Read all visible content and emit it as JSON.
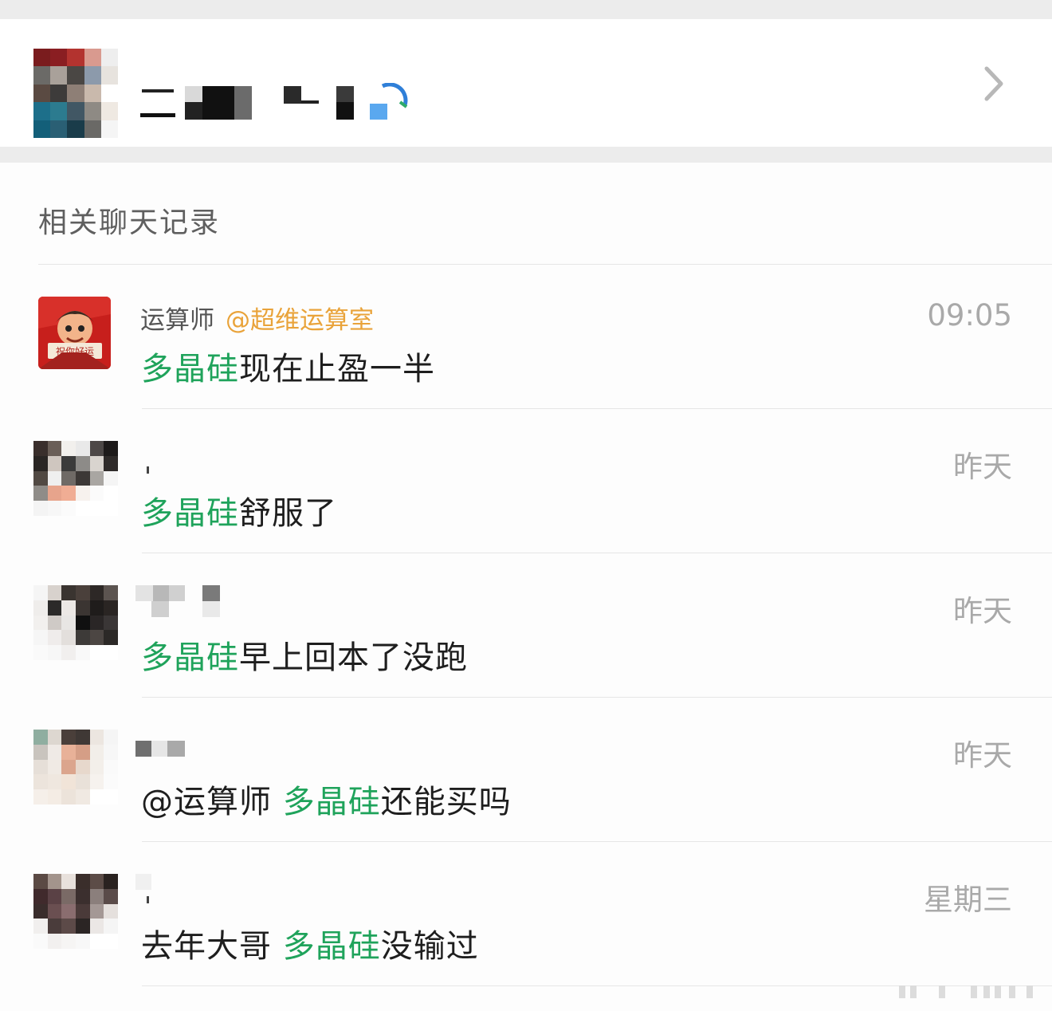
{
  "contact": {
    "name": "",
    "avatar_colors": [
      "#7a1c1e",
      "#8a1e22",
      "#b3332f",
      "#d99a8f",
      "#eeeeee",
      "#6b6a67",
      "#a9a19a",
      "#4a4744",
      "#8c9aab",
      "#e7e3de",
      "#5a4a42",
      "#3d3b3a",
      "#8e7f76",
      "#c9b9ac",
      "#ffffff",
      "#1d6f8a",
      "#2c7b8f",
      "#415764",
      "#8e8a84",
      "#efe9e2",
      "#135f79",
      "#2a5f74",
      "#1a3c4a",
      "#6a6966",
      "#f5f5f5"
    ],
    "chevron_icon": "chevron-right-icon"
  },
  "section": {
    "title": "相关聊天记录"
  },
  "colors": {
    "keyword": "#1fa35b",
    "group_mention": "#e9a33a",
    "time": "#a9a9a9"
  },
  "results": [
    {
      "sender": "运算师",
      "group": "@超维运算室",
      "time": "09:05",
      "keyword": "多晶硅",
      "before": "",
      "after": "现在止盈一半",
      "avatar_caption": "祝你好运"
    },
    {
      "sender": "",
      "group": "",
      "time": "昨天",
      "keyword": "多晶硅",
      "before": "",
      "after": "舒服了",
      "avatar_colors": [
        "#3a2f2c",
        "#6a5e57",
        "#f2f0ed",
        "#e9e9e9",
        "#4d4847",
        "#1d1a1a",
        "#2a2624",
        "#cfc6bf",
        "#3b3b3b",
        "#8d8b88",
        "#d9d4cf",
        "#2f2b2a",
        "#514943",
        "#efefef",
        "#6f6a66",
        "#3c3836",
        "#a9a6a2",
        "#f5f5f5",
        "#8f8c88",
        "#e7a48c",
        "#f0ad94",
        "#f7f2ee",
        "#fbfbfb",
        "#ffffff",
        "#f4f4f4",
        "#f7f7f7",
        "#fbfbfb",
        "#ffffff",
        "#ffffff",
        "#ffffff"
      ]
    },
    {
      "sender": "",
      "group": "",
      "time": "昨天",
      "keyword": "多晶硅",
      "before": "",
      "after": "早上回本了没跑",
      "avatar_colors": [
        "#f5f5f5",
        "#d8d2cd",
        "#3a3430",
        "#4a403b",
        "#2d2826",
        "#5c5450",
        "#efedeb",
        "#2b2a29",
        "#ece8e5",
        "#3b3532",
        "#1f1c1b",
        "#2a2523",
        "#f2f0ee",
        "#cfcac6",
        "#e8e6e4",
        "#101010",
        "#2a2626",
        "#3a3636",
        "#f6f6f6",
        "#efeceb",
        "#e3dfdc",
        "#3d3a38",
        "#4c4643",
        "#2c2927",
        "#fafafa",
        "#f7f7f7",
        "#f1efee",
        "#f9f9f9",
        "#ffffff",
        "#ffffff"
      ]
    },
    {
      "sender": "",
      "group": "",
      "time": "昨天",
      "keyword": "多晶硅",
      "before": "@运算师 ",
      "after": "还能买吗",
      "avatar_colors": [
        "#8faea0",
        "#ddd7d0",
        "#4a3f3a",
        "#3f3835",
        "#ece6e0",
        "#f5f5f5",
        "#c9c4be",
        "#efeae6",
        "#e8b198",
        "#d59e86",
        "#f2eee9",
        "#f7f7f7",
        "#e6dfd8",
        "#f0eae4",
        "#dba58d",
        "#e7d8cc",
        "#f3efea",
        "#fafafa",
        "#ece4dc",
        "#efe7df",
        "#f1e4d8",
        "#e9e1d9",
        "#f6f2ee",
        "#fbfbfb",
        "#f5efe9",
        "#f4ece4",
        "#ece3da",
        "#f0e9e2",
        "#ffffff",
        "#ffffff"
      ]
    },
    {
      "sender": "",
      "group": "",
      "time": "星期三",
      "keyword": "多晶硅",
      "before": "去年大哥 ",
      "after": "没输过",
      "avatar_colors": [
        "#5b4a44",
        "#a3948c",
        "#e8e1dc",
        "#3a2e2b",
        "#5c4c47",
        "#2a2220",
        "#402a2c",
        "#5a4145",
        "#7a6a66",
        "#3b2f2e",
        "#8b7f7c",
        "#5a4b49",
        "#3a2d2c",
        "#6a4f51",
        "#8a6d6f",
        "#4a3a39",
        "#a49895",
        "#e5e0dd",
        "#f1efee",
        "#4a3c3b",
        "#5c4a48",
        "#2b2524",
        "#ebe7e5",
        "#f5f5f5",
        "#fafafa",
        "#f2f0ef",
        "#f6f5f4",
        "#f8f8f8",
        "#ffffff",
        "#ffffff"
      ]
    }
  ]
}
